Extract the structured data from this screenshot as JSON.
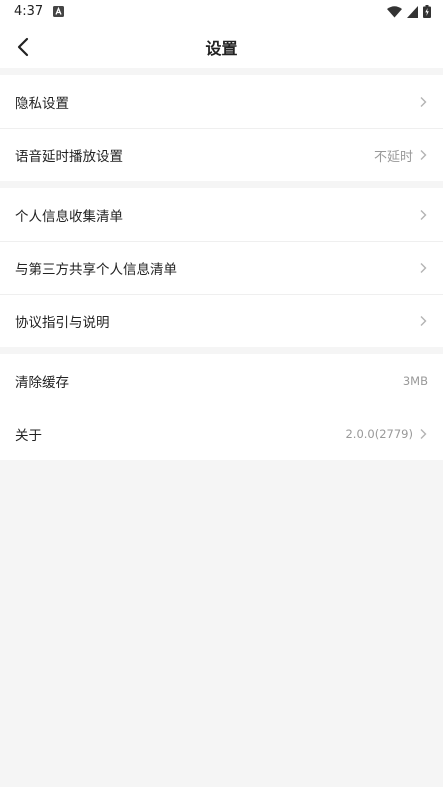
{
  "status_bar": {
    "time": "4:37",
    "icons": [
      "notification-a-icon",
      "wifi-icon",
      "signal-icon",
      "battery-charging-icon"
    ]
  },
  "header": {
    "title": "设置",
    "back_icon": "chevron-left-icon"
  },
  "groups": [
    {
      "items": [
        {
          "label": "隐私设置",
          "value": "",
          "icon": "chevron-right-icon"
        },
        {
          "label": "语音延时播放设置",
          "value": "不延时",
          "icon": "chevron-right-icon"
        }
      ]
    },
    {
      "items": [
        {
          "label": "个人信息收集清单",
          "value": "",
          "icon": "chevron-right-icon"
        },
        {
          "label": "与第三方共享个人信息清单",
          "value": "",
          "icon": "chevron-right-icon"
        },
        {
          "label": "协议指引与说明",
          "value": "",
          "icon": "chevron-right-icon"
        }
      ]
    },
    {
      "items": [
        {
          "label": "清除缓存",
          "value": "3MB"
        },
        {
          "label": "关于",
          "value": "2.0.0(2779)",
          "icon": "chevron-right-icon"
        }
      ]
    }
  ],
  "colors": {
    "background": "#f5f5f5",
    "card": "#ffffff",
    "text_primary": "#222222",
    "text_secondary": "#999999",
    "divider": "#efefef",
    "chevron": "#b3b3b3"
  }
}
